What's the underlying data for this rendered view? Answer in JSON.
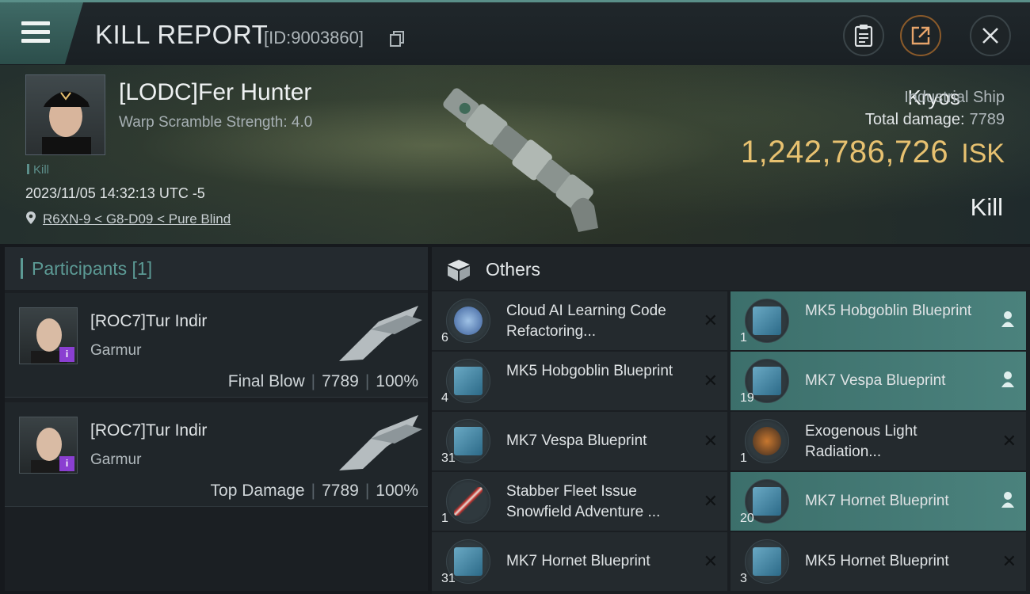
{
  "header": {
    "title": "KILL REPORT",
    "report_id": "[ID:9003860]",
    "icons": [
      "menu-icon",
      "copy-icon",
      "clipboard-icon",
      "share-icon",
      "close-icon"
    ]
  },
  "victim": {
    "name": "[LODC]Fer Hunter",
    "subtitle": "Warp Scramble Strength: 4.0",
    "tag": "Kill",
    "datetime": "2023/11/05 14:32:13 UTC -5",
    "location": "R6XN-9 < G8-D09 < Pure Blind",
    "ship_name": "Kryos",
    "ship_class": "Industrial Ship",
    "total_damage_label": "Total damage:",
    "total_damage": "7789",
    "isk_value": "1,242,786,726",
    "isk_unit": "ISK",
    "result": "Kill"
  },
  "participants": {
    "title": "Participants [1]",
    "rows": [
      {
        "name": "[ROC7]Tur Indir",
        "ship": "Garmur",
        "role": "Final Blow",
        "damage": "7789",
        "percent": "100%",
        "badge": "i"
      },
      {
        "name": "[ROC7]Tur Indir",
        "ship": "Garmur",
        "role": "Top Damage",
        "damage": "7789",
        "percent": "100%",
        "badge": "i"
      }
    ]
  },
  "others": {
    "title": "Others",
    "items": [
      {
        "qty": "6",
        "name": "Cloud AI Learning Code Refactoring...",
        "status": "destroyed"
      },
      {
        "qty": "1",
        "name": "MK5 Hobgoblin Blueprint",
        "status": "dropped"
      },
      {
        "qty": "4",
        "name": "MK5 Hobgoblin Blueprint",
        "status": "destroyed"
      },
      {
        "qty": "19",
        "name": "MK7 Vespa Blueprint",
        "status": "dropped"
      },
      {
        "qty": "31",
        "name": "MK7 Vespa Blueprint",
        "status": "destroyed"
      },
      {
        "qty": "1",
        "name": "Exogenous Light Radiation...",
        "status": "destroyed"
      },
      {
        "qty": "1",
        "name": "Stabber Fleet Issue Snowfield Adventure ...",
        "status": "destroyed"
      },
      {
        "qty": "20",
        "name": "MK7 Hornet Blueprint",
        "status": "dropped"
      },
      {
        "qty": "31",
        "name": "MK7 Hornet Blueprint",
        "status": "destroyed"
      },
      {
        "qty": "3",
        "name": "MK5 Hornet Blueprint",
        "status": "destroyed"
      }
    ]
  },
  "colors": {
    "accent": "#5c9a95",
    "isk": "#e7c170",
    "highlight": "#4b827d",
    "badge": "#8a3fd1"
  }
}
